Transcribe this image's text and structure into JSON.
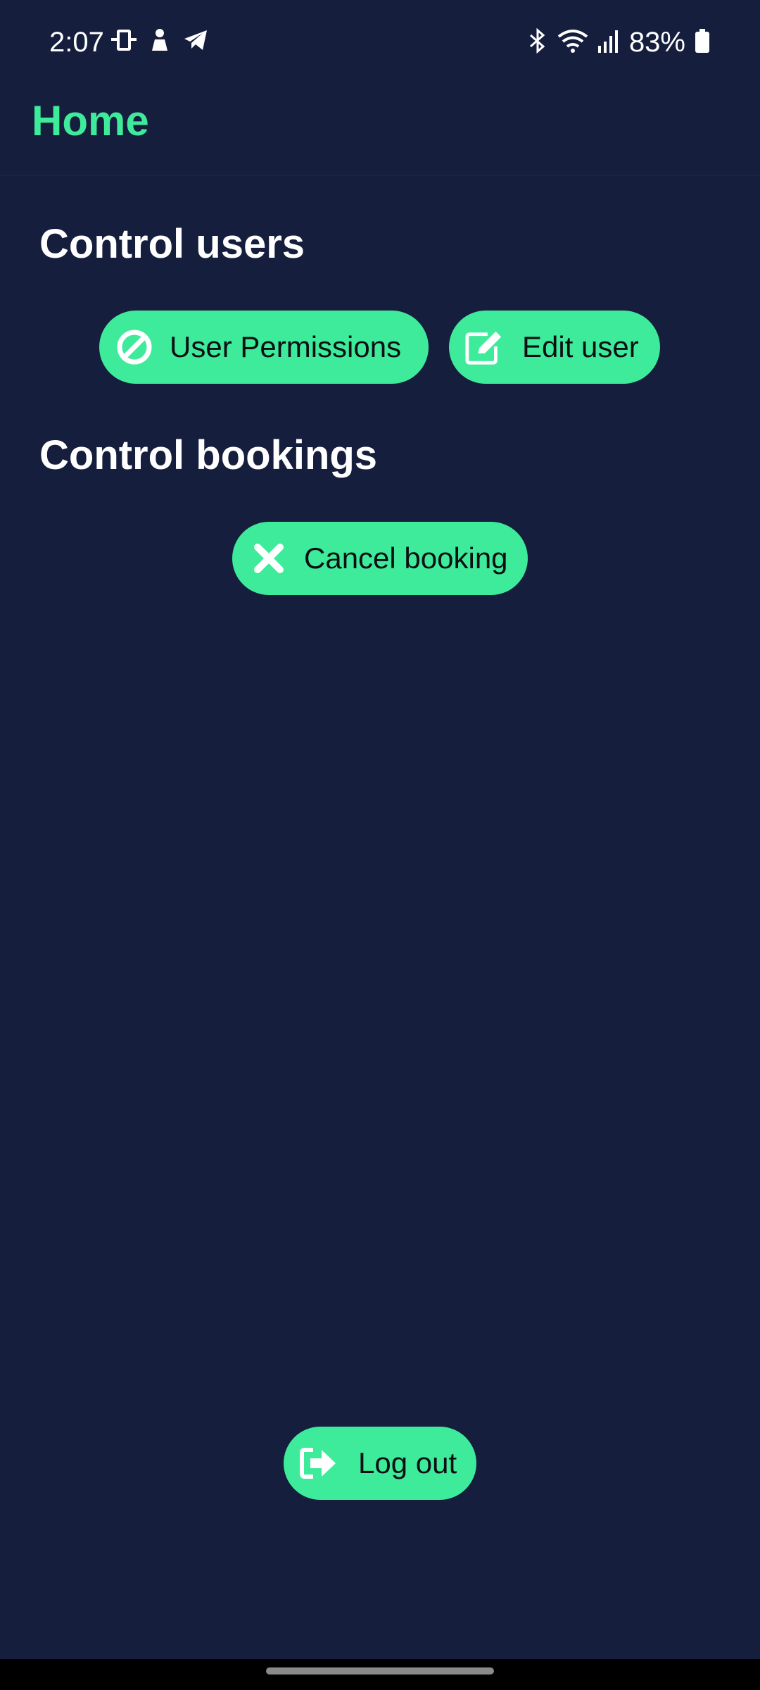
{
  "status_bar": {
    "time": "2:07",
    "battery_pct": "83%",
    "left_icons": [
      "device-icon",
      "person-icon",
      "telegram-icon"
    ],
    "right_icons": [
      "bluetooth-icon",
      "wifi-icon",
      "signal-icon",
      "battery-icon"
    ]
  },
  "app_bar": {
    "title": "Home"
  },
  "sections": {
    "users": {
      "title": "Control users",
      "buttons": {
        "permissions": {
          "label": "User Permissions",
          "icon": "block-icon"
        },
        "edit_user": {
          "label": "Edit user",
          "icon": "edit-icon"
        }
      }
    },
    "bookings": {
      "title": "Control bookings",
      "buttons": {
        "cancel": {
          "label": "Cancel booking",
          "icon": "close-icon"
        }
      }
    }
  },
  "logout": {
    "label": "Log out",
    "icon": "logout-icon"
  },
  "colors": {
    "background": "#161e3d",
    "accent": "#3deb9a",
    "text": "#ffffff"
  }
}
